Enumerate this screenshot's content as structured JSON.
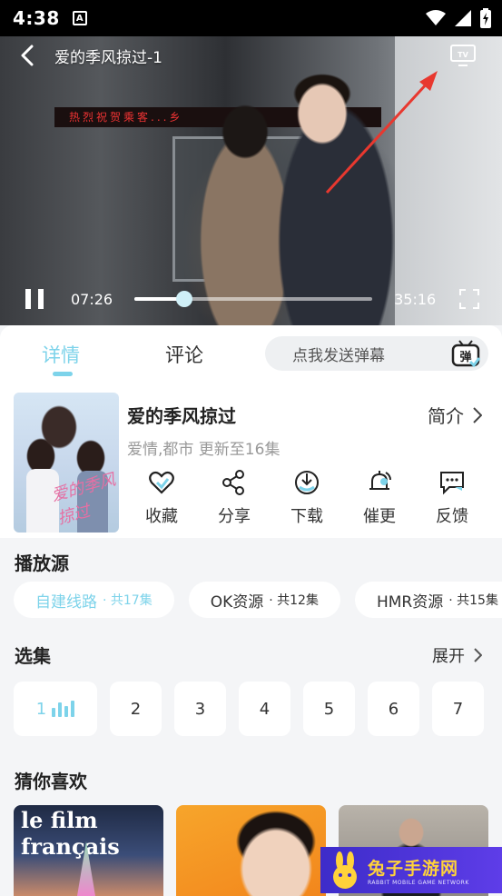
{
  "status_bar": {
    "time": "4:38",
    "notif_letter": "A"
  },
  "player": {
    "title": "爱的季风掠过-1",
    "current_time": "07:26",
    "duration": "35:16",
    "progress_fraction": 0.211,
    "sign_text": "热烈祝贺乘客...乡"
  },
  "tabs": {
    "details": "详情",
    "comments": "评论",
    "danmu_placeholder": "点我发送弹幕",
    "danmu_icon_label": "弹"
  },
  "show": {
    "title": "爱的季风掠过",
    "intro_label": "简介",
    "meta": "爱情,都市 更新至16集",
    "poster_text": "爱的季风掠过"
  },
  "actions": [
    {
      "label": "收藏",
      "icon": "heart-icon"
    },
    {
      "label": "分享",
      "icon": "share-icon"
    },
    {
      "label": "下载",
      "icon": "download-icon"
    },
    {
      "label": "催更",
      "icon": "bell-icon"
    },
    {
      "label": "反馈",
      "icon": "feedback-icon"
    }
  ],
  "sources": {
    "heading": "播放源",
    "items": [
      {
        "name": "自建线路",
        "count": "· 共17集"
      },
      {
        "name": "OK资源",
        "count": "· 共12集"
      },
      {
        "name": "HMR资源",
        "count": "· 共15集"
      }
    ]
  },
  "episodes": {
    "heading": "选集",
    "expand_label": "展开",
    "items": [
      "1",
      "2",
      "3",
      "4",
      "5",
      "6",
      "7"
    ]
  },
  "recommend": {
    "heading": "猜你喜欢",
    "first_cover_text": "le film français"
  },
  "watermark": {
    "title": "兔子手游网",
    "subtitle": "RABBIT MOBILE GAME NETWORK"
  },
  "colors": {
    "accent": "#7dd3ea",
    "annotation_arrow": "#e8382f"
  }
}
